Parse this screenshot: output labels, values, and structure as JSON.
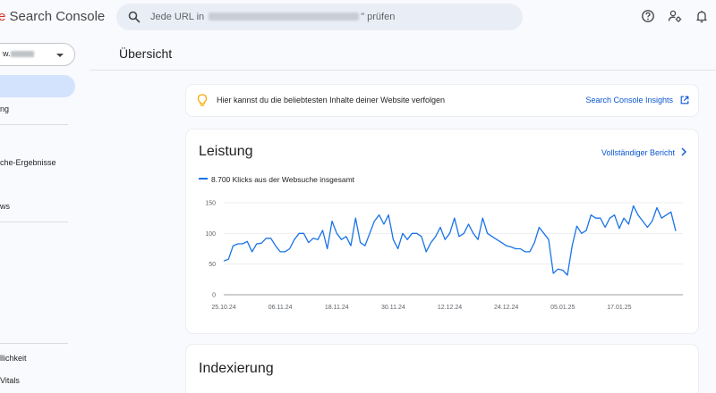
{
  "header": {
    "logo_prefix": "e",
    "logo_text": " Search Console",
    "search_placeholder_start": "Jede URL in",
    "search_placeholder_end": "\" prüfen",
    "icons": [
      "search-icon",
      "help-icon",
      "admin-icon",
      "notifications-icon"
    ]
  },
  "sidebar": {
    "property_value": "w.",
    "items": [
      {
        "label": "ng"
      },
      {
        "label": "che-Ergebnisse"
      },
      {
        "label": "ws"
      },
      {
        "label": "llichkeit"
      },
      {
        "label": "Vitals"
      }
    ]
  },
  "main": {
    "page_title": "Übersicht",
    "insight": {
      "text": "Hier kannst du die beliebtesten Inhalte deiner Website verfolgen",
      "link": "Search Console Insights"
    },
    "performance": {
      "title": "Leistung",
      "link": "Vollständiger Bericht",
      "legend": "8.700 Klicks aus der Websuche insgesamt"
    },
    "indexing": {
      "title": "Indexierung"
    }
  },
  "colors": {
    "accent": "#0b57d0",
    "line": "#1a73e8",
    "nav_active": "#d3e3fd",
    "search_bg": "#e9eef6"
  },
  "chart_data": {
    "type": "line",
    "ylim": [
      0,
      150
    ],
    "y_ticks": [
      0,
      50,
      100,
      150
    ],
    "x_tick_labels": [
      "25.10.24",
      "06.11.24",
      "18.11.24",
      "30.11.24",
      "12.12.24",
      "24.12.24",
      "05.01.25",
      "17.01.25"
    ],
    "series": [
      {
        "values": [
          55,
          58,
          80,
          83,
          83,
          87,
          70,
          83,
          84,
          92,
          92,
          80,
          70,
          70,
          75,
          90,
          100,
          100,
          85,
          92,
          90,
          105,
          75,
          120,
          100,
          90,
          95,
          80,
          125,
          85,
          80,
          100,
          120,
          130,
          115,
          130,
          90,
          75,
          100,
          90,
          100,
          100,
          95,
          70,
          85,
          95,
          110,
          90,
          100,
          125,
          95,
          100,
          115,
          100,
          90,
          125,
          100,
          95,
          90,
          85,
          80,
          78,
          75,
          75,
          70,
          70,
          85,
          110,
          100,
          90,
          35,
          42,
          40,
          32,
          80,
          112,
          100,
          105,
          130,
          125,
          125,
          110,
          125,
          130,
          108,
          125,
          115,
          145,
          130,
          120,
          110,
          120,
          142,
          125,
          130,
          135,
          104
        ]
      }
    ]
  }
}
